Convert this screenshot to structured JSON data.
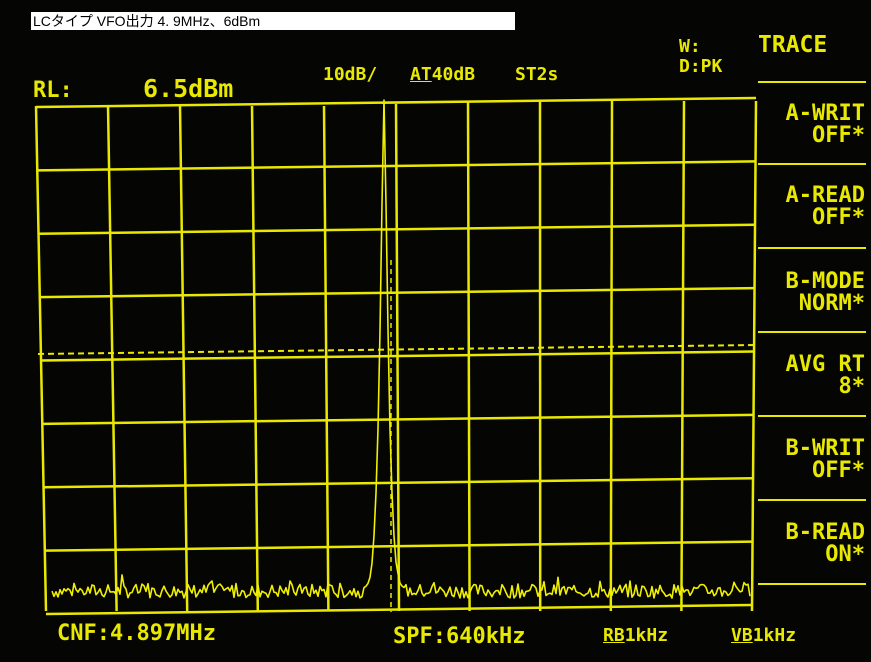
{
  "caption": {
    "text": "LCタイプ  VFO出力  4. 9MHz、6dBm"
  },
  "header": {
    "ref_level_label": "RL:",
    "ref_level_value": "6.5dBm",
    "scale": "10dB/",
    "attenuator_prefix": "AT",
    "attenuator_value": "40dB",
    "sweep_time": "ST2s",
    "trace_w": "W:",
    "trace_d": "D:PK"
  },
  "menu": {
    "title": "TRACE",
    "softkeys": [
      {
        "line1": "A-WRIT",
        "line2": "OFF*"
      },
      {
        "line1": "A-READ",
        "line2": "OFF*"
      },
      {
        "line1": "B-MODE",
        "line2": "NORM*"
      },
      {
        "line1": "AVG RT",
        "line2": "8*"
      },
      {
        "line1": "B-WRIT",
        "line2": "OFF*"
      },
      {
        "line1": "B-READ",
        "line2": "ON*"
      }
    ]
  },
  "footer": {
    "center_freq": "CNF:4.897MHz",
    "span": "SPF:640kHz",
    "rbw_prefix": "RB",
    "rbw_value": "1kHz",
    "vbw_prefix": "VB",
    "vbw_value": "1kHz"
  },
  "colors": {
    "trace": "#e8e800",
    "background": "#050503"
  }
}
